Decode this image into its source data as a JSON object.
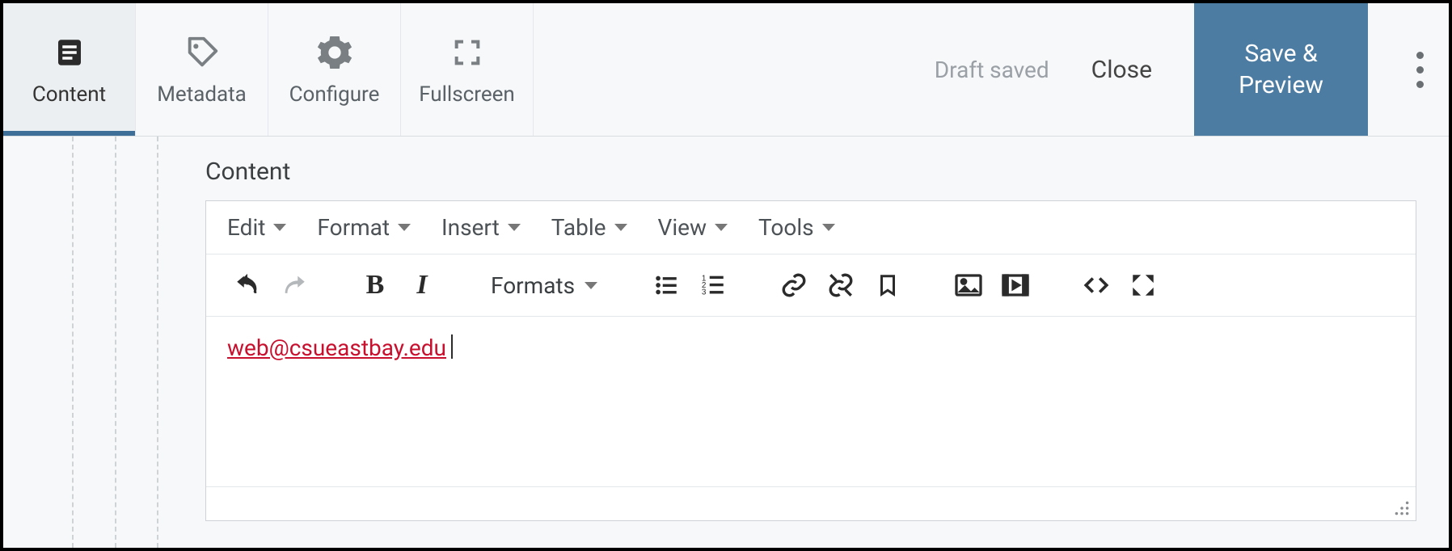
{
  "tabs": {
    "content": "Content",
    "metadata": "Metadata",
    "configure": "Configure",
    "fullscreen": "Fullscreen"
  },
  "status": "Draft saved",
  "actions": {
    "close": "Close",
    "save_preview": "Save &\nPreview"
  },
  "section_label": "Content",
  "editor_menu": {
    "edit": "Edit",
    "format": "Format",
    "insert": "Insert",
    "table": "Table",
    "view": "View",
    "tools": "Tools"
  },
  "toolbar": {
    "formats_label": "Formats"
  },
  "editor_content": {
    "link_text": "web@csueastbay.edu"
  },
  "colors": {
    "primary": "#4d7ca3",
    "link": "#c8102e"
  }
}
